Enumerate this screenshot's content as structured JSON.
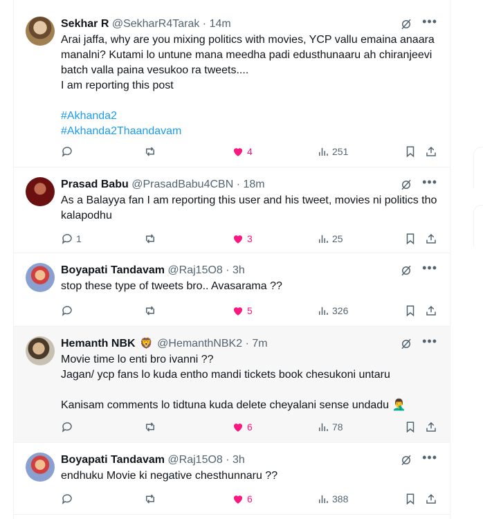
{
  "tweets": [
    {
      "name": "Sekhar R",
      "handle": "@SekharR4Tarak",
      "dot": " · ",
      "time": "14m",
      "badge": "",
      "text": "Arai jaffa, why are you mixing politics with movies, YCP vallu emaina anaara manalni? Kutami lo untune mana meedha padi edusthunaaru ah chiranjeevi batch valla paina vesukoo ra tweets....\nI am reporting this post\n\n",
      "hashtags": [
        "#Akhanda2",
        "#Akhanda2Thaandavam"
      ],
      "replies": "",
      "reposts": "",
      "likes": "4",
      "views": "251"
    },
    {
      "name": "Prasad Babu",
      "handle": "@PrasadBabu4CBN",
      "dot": " · ",
      "time": "18m",
      "badge": "",
      "text": "As a Balayya fan I am reporting this user and his tweet, movies ni politics tho kalapodhu",
      "hashtags": [],
      "replies": "1",
      "reposts": "",
      "likes": "3",
      "views": "25"
    },
    {
      "name": "Boyapati Tandavam",
      "handle": "@Raj15O8",
      "dot": " · ",
      "time": "3h",
      "badge": "",
      "text": "stop these type of tweets bro.. Avasarama ??",
      "hashtags": [],
      "replies": "",
      "reposts": "",
      "likes": "5",
      "views": "326"
    },
    {
      "name": "Hemanth NBK",
      "handle": "@HemanthNBK2",
      "dot": " · ",
      "time": "7m",
      "badge": "🦁",
      "text": "Movie time lo enti bro ivanni ??\nJagan/ ycp fans lo kuda entho mandi tickets book chesukoni untaru\n\nKanisam comments lo tidtuna kuda delete cheyalani sense undadu 🤦‍♂️",
      "hashtags": [],
      "replies": "",
      "reposts": "",
      "likes": "6",
      "views": "78"
    },
    {
      "name": "Boyapati Tandavam",
      "handle": "@Raj15O8",
      "dot": " · ",
      "time": "3h",
      "badge": "",
      "text": "endhuku Movie ki negative chesthunnaru ??",
      "hashtags": [],
      "replies": "",
      "reposts": "",
      "likes": "6",
      "views": "388"
    }
  ],
  "icons": {
    "more": "more-icon",
    "grok": "grok-icon",
    "reply": "reply-icon",
    "repost": "repost-icon",
    "like": "heart-icon",
    "views": "views-icon",
    "bookmark": "bookmark-icon",
    "share": "share-icon"
  },
  "colors": {
    "like": "#f91880",
    "hashtag": "#1d9bf0",
    "meta": "#536471",
    "highlight_bg": "#f7f7f7"
  }
}
